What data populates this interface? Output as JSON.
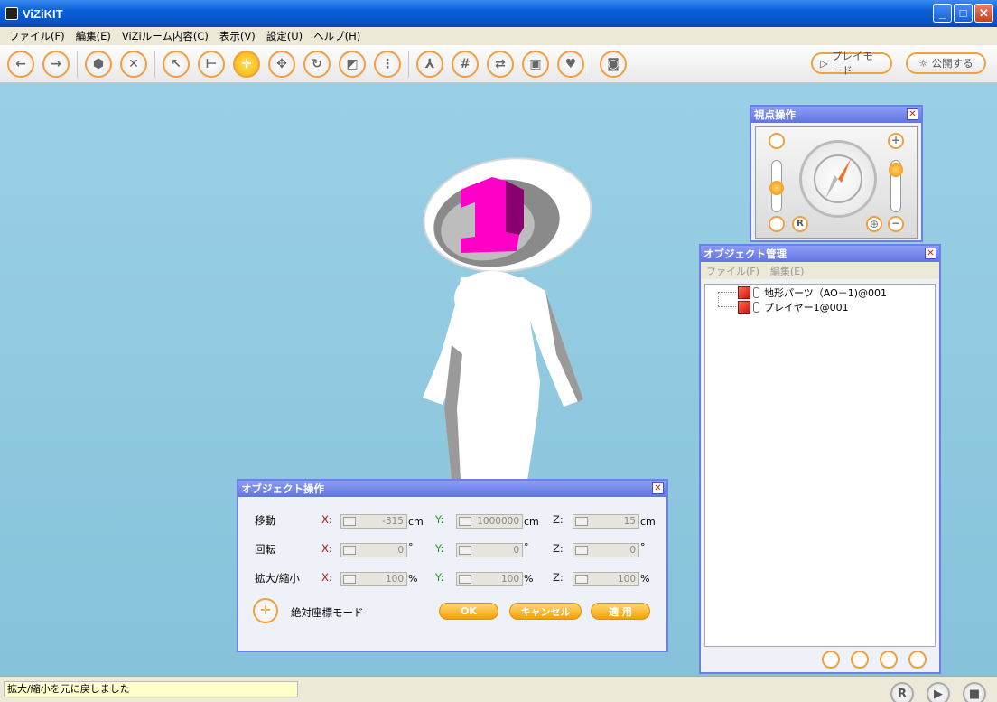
{
  "window": {
    "title": "ViZiKIT"
  },
  "menu": [
    "ファイル(F)",
    "編集(E)",
    "ViZiルーム内容(C)",
    "表示(V)",
    "設定(U)",
    "ヘルプ(H)"
  ],
  "toolbar": {
    "play_mode": "プレイモード",
    "publish": "公開する"
  },
  "view_panel": {
    "title": "視点操作",
    "reset": "R"
  },
  "object_manager": {
    "title": "オブジェクト管理",
    "menu": [
      "ファイル(F)",
      "編集(E)"
    ],
    "items": [
      "地形パーツ（AO－1)@001",
      "プレイヤー1@001"
    ]
  },
  "object_op": {
    "title": "オブジェクト操作",
    "rows": [
      {
        "label": "移動",
        "x": "-315",
        "y": "1000000",
        "z": "15",
        "unit": "cm"
      },
      {
        "label": "回転",
        "x": "0",
        "y": "0",
        "z": "0",
        "unit": "°"
      },
      {
        "label": "拡大/縮小",
        "x": "100",
        "y": "100",
        "z": "100",
        "unit": "%"
      }
    ],
    "axis": {
      "x": "X:",
      "y": "Y:",
      "z": "Z:"
    },
    "absolute_mode": "絶対座標モード",
    "ok": "OK",
    "cancel": "キャンセル",
    "apply": "適 用"
  },
  "status": {
    "message": "拡大/縮小を元に戻しました",
    "rec": "R"
  },
  "colors": {
    "accent": "#f0a040",
    "panel_title": "#6e7ee8",
    "viewport": "#93cae1",
    "character": "#ffffff",
    "number_model": "#ff00c8"
  }
}
